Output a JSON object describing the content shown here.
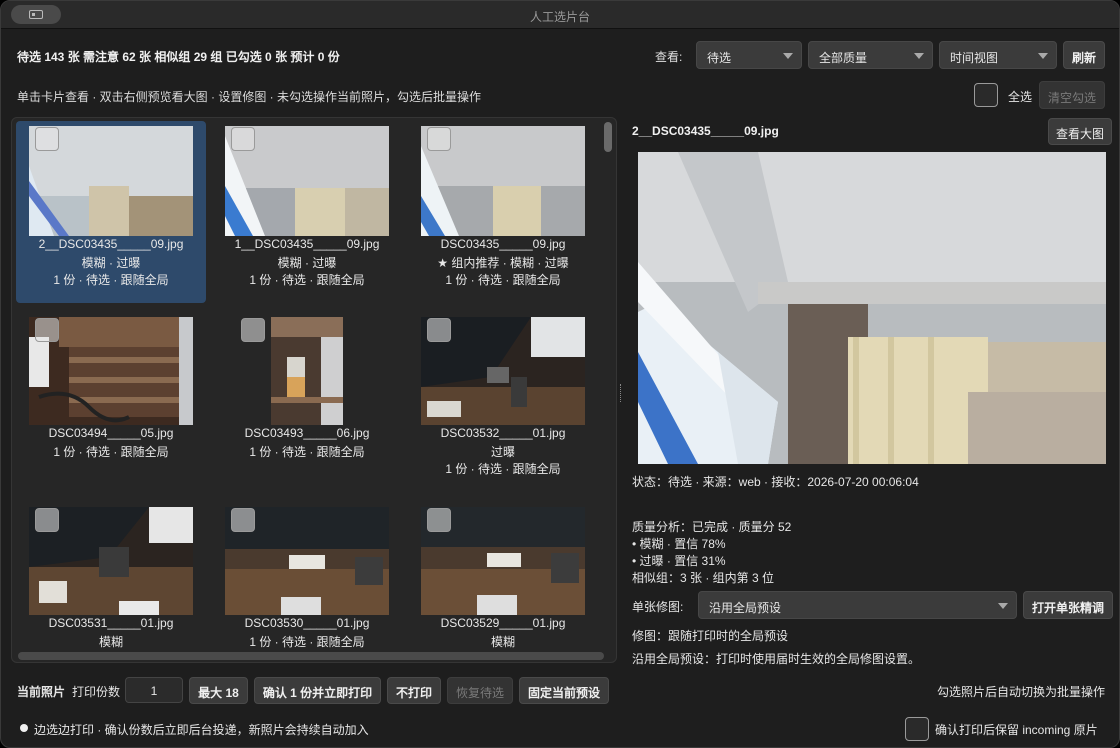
{
  "window": {
    "title": "人工选片台"
  },
  "stats_text": "待选 143 张  需注意 62 张  相似组 29 组  已勾选 0 张  预计 0 份",
  "hint_text": "单击卡片查看 · 双击右侧预览看大图 · 设置修图 · 未勾选操作当前照片，勾选后批量操作",
  "view": {
    "label": "查看:",
    "filter_status": "待选",
    "filter_quality": "全部质量",
    "filter_view": "时间视图",
    "refresh": "刷新"
  },
  "select_all": {
    "label": "全选",
    "clear": "清空勾选"
  },
  "cards": [
    {
      "name": "2__DSC03435_____09.jpg",
      "tags": "模糊 · 过曝",
      "meta": "1 份 · 待选 · 跟随全局",
      "selected": true
    },
    {
      "name": "1__DSC03435_____09.jpg",
      "tags": "模糊 · 过曝",
      "meta": "1 份 · 待选 · 跟随全局"
    },
    {
      "name": "DSC03435_____09.jpg",
      "tags": "★ 组内推荐 · 模糊 · 过曝",
      "meta": "1 份 · 待选 · 跟随全局"
    },
    {
      "name": "DSC03494_____05.jpg",
      "tags": "1 份 · 待选 · 跟随全局",
      "meta": ""
    },
    {
      "name": "DSC03493_____06.jpg",
      "tags": "1 份 · 待选 · 跟随全局",
      "meta": ""
    },
    {
      "name": "DSC03532_____01.jpg",
      "tags": "过曝",
      "meta": "1 份 · 待选 · 跟随全局"
    },
    {
      "name": "DSC03531_____01.jpg",
      "tags": "模糊",
      "meta": ""
    },
    {
      "name": "DSC03530_____01.jpg",
      "tags": "1 份 · 待选 · 跟随全局",
      "meta": ""
    },
    {
      "name": "DSC03529_____01.jpg",
      "tags": "模糊",
      "meta": ""
    }
  ],
  "detail": {
    "filename": "2__DSC03435_____09.jpg",
    "view_large": "查看大图",
    "status_line": "状态：待选  ·  来源：web  ·  接收：2026-07-20 00:06:04",
    "quality_line": "质量分析：已完成  ·  质量分 52",
    "blur_line": "• 模糊 · 置信 78%",
    "overexposed_line": "• 过曝 · 置信 31%",
    "similar_line": "相似组：3 张 · 组内第 3 位",
    "retouch_label": "单张修图:",
    "retouch_select": "沿用全局预设",
    "open_retouch": "打开单张精调",
    "retouch_line": "修图：跟随打印时的全局预设",
    "preset_line": "沿用全局预设：打印时使用届时生效的全局修图设置。"
  },
  "bottom": {
    "current_label": "当前照片",
    "copies_label": "打印份数",
    "copies_value": "1",
    "max_button": "最大 18",
    "confirm_button": "确认 1 份并立即打印",
    "noprint_button": "不打印",
    "restore_button": "恢复待选",
    "fix_button": "固定当前预设",
    "batch_hint": "勾选照片后自动切换为批量操作",
    "live_text": "边选边打印 · 确认份数后立即后台投递，新照片会持续自动加入",
    "keep_label": "确认打印后保留 incoming 原片"
  }
}
